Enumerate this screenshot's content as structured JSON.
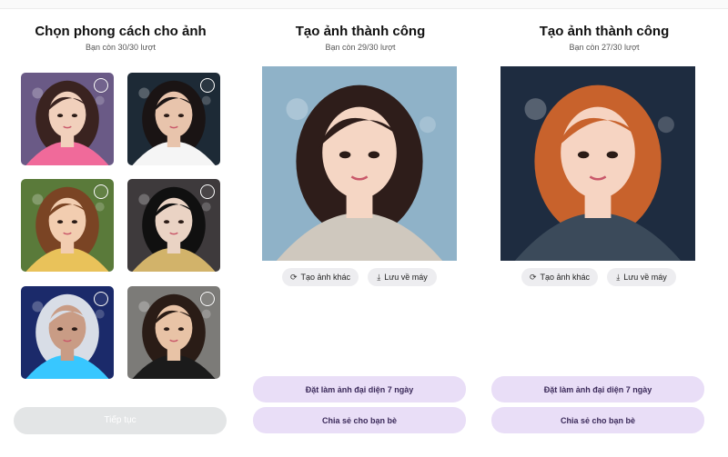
{
  "style_panel": {
    "title": "Chọn phong cách cho ảnh",
    "subtitle": "Bạn còn 30/30 lượt",
    "continue_label": "Tiếp tục",
    "styles": [
      {
        "bg": "#6a5a86",
        "hair": "#3a2320",
        "skin": "#f1d0bc",
        "accent": "#f06a9a"
      },
      {
        "bg": "#1d2a36",
        "hair": "#1a1414",
        "skin": "#e8c4ac",
        "accent": "#f5f5f5"
      },
      {
        "bg": "#5a7a3a",
        "hair": "#7a4424",
        "skin": "#f2cdb0",
        "accent": "#e9c25a"
      },
      {
        "bg": "#3e3a3c",
        "hair": "#101010",
        "skin": "#ead3c4",
        "accent": "#d2b36a"
      },
      {
        "bg": "#1b2a6a",
        "hair": "#d8dde6",
        "skin": "#c99c85",
        "accent": "#38c7ff"
      },
      {
        "bg": "#7c7b78",
        "hair": "#2a1c16",
        "skin": "#e8c3a6",
        "accent": "#1b1b1b"
      }
    ]
  },
  "result_panels": [
    {
      "title": "Tạo ảnh thành công",
      "subtitle": "Bạn còn 29/30 lượt",
      "regen_label": "Tạo ảnh khác",
      "save_label": "Lưu về máy",
      "avatar_label": "Đặt làm ảnh đại diện 7 ngày",
      "share_label": "Chia sẻ cho bạn bè",
      "colors": {
        "bg": "#8fb2c8",
        "hair": "#2e1d1a",
        "skin": "#f5d6c4",
        "shirt": "#cfc8be"
      }
    },
    {
      "title": "Tạo ảnh thành công",
      "subtitle": "Bạn còn 27/30 lượt",
      "regen_label": "Tạo ảnh khác",
      "save_label": "Lưu về máy",
      "avatar_label": "Đặt làm ảnh đại diện 7 ngày",
      "share_label": "Chia sẻ cho bạn bè",
      "colors": {
        "bg": "#1e2c40",
        "hair": "#c8622c",
        "skin": "#f6d4c2",
        "shirt": "#3b4a5a"
      }
    }
  ],
  "icons": {
    "regen": "refresh-icon",
    "save": "download-icon",
    "radio": "radio-unselected-icon"
  }
}
